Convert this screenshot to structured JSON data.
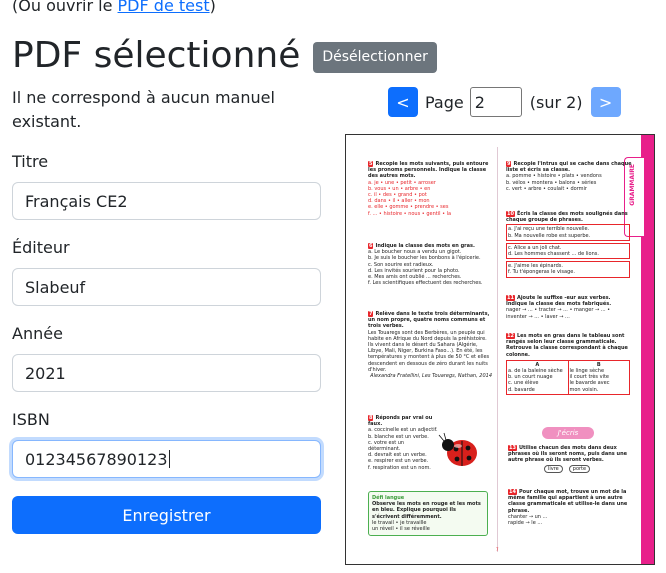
{
  "header": {
    "open_prefix": "(Ou ouvrir le ",
    "open_link": "PDF de test",
    "open_suffix": ")",
    "title": "PDF sélectionné",
    "deselect_label": "Désélectionner"
  },
  "form": {
    "note": "Il ne correspond à aucun manuel existant.",
    "title_label": "Titre",
    "title_value": "Français CE2",
    "publisher_label": "Éditeur",
    "publisher_value": "Slabeuf",
    "year_label": "Année",
    "year_value": "2021",
    "isbn_label": "ISBN",
    "isbn_value": "01234567890123",
    "save_label": "Enregistrer"
  },
  "pager": {
    "prev_label": "<",
    "page_word": "Page",
    "page_value": "2",
    "total_text": "(sur 2)",
    "next_label": ">"
  },
  "pdf": {
    "side_tab": "GRAMMAIRE",
    "page_number": "7",
    "write_banner": "J'écris",
    "ex5": {
      "num": "5",
      "title": "Recopie les mots suivants, puis entoure les pronoms personnels. Indique la classe des autres mots.",
      "lines": [
        "a. je • une • petit • arroser",
        "b. vous • un • arbre • en",
        "c. il • des • grand • pot",
        "d. dans • il • aller • mon",
        "e. elle • gomme • prendre • ses",
        "f. ... • histoire • nous • gentil • la"
      ]
    },
    "ex6": {
      "num": "6",
      "title": "Indique la classe des mots en gras.",
      "lines": [
        "a. Le boucher nous a vendu un gigot.",
        "b. Je suis le boucher les bonbons à l'épicerie.",
        "c. Son sourire est radieux.",
        "d. Les invités sourient pour la photo.",
        "e. Mes amis ont oublié ... recherches.",
        "f. Les scientifiques effectuent des recherches."
      ]
    },
    "ex7": {
      "num": "7",
      "title": "Relève dans le texte trois déterminants, un nom propre, quatre noms communs et trois verbes.",
      "text": "Les Touaregs sont des Berbères, un peuple qui habite en Afrique du Nord depuis la préhistoire. Ils vivent dans le désert du Sahara (Algérie, Libye, Mali, Niger, Burkina Faso...). En été, les températures y montent à plus de 50 °C et elles descendent en dessous de zéro durant les nuits d'hiver.",
      "source": "Alexandra Fratellini, Les Touaregs, Nathan, 2014"
    },
    "ex8": {
      "num": "8",
      "title": "Réponds par vrai ou faux.",
      "lines": [
        "a. coccinelle est un adjectif.",
        "b. blanche est un verbe.",
        "c. votre est un déterminant.",
        "d. devrait est un verbe.",
        "e. respirer est un verbe.",
        "f. respiration est un nom."
      ]
    },
    "defi": {
      "label": "Défi langue",
      "text": "Observe les mots en rouge et les mots en bleu. Explique pourquoi ils s'écrivent différemment.",
      "lines": [
        "le travail • je travaille",
        "un réveil • il se réveille"
      ]
    },
    "ex9": {
      "num": "9",
      "title": "Recopie l'intrus qui se cache dans chaque liste et écris sa classe.",
      "lines": [
        "a. pomme • histoire • plats • vendons",
        "b. vélos • montera • balons • séries",
        "c. vert • arbre • coulait • dormir"
      ]
    },
    "ex10": {
      "num": "10",
      "title": "Écris la classe des mots soulignés dans chaque groupe de phrases.",
      "lines": [
        "a. J'ai reçu une terrible nouvelle.",
        "b. Ma nouvelle robe est superbe.",
        "c. Alice a un joli chat.",
        "d. Les hommes chassent ... de lions.",
        "e. J'aime les épinards.",
        "f. Tu t'épongeras le visage."
      ]
    },
    "ex11": {
      "num": "11",
      "title": "Ajoute le suffixe -eur aux verbes. Indique la classe des mots fabriqués.",
      "text": "nager → ... • tracter → ... • manger → ... • inventer → ... • laver → ..."
    },
    "ex12": {
      "num": "12",
      "title": "Les mots en gras dans le tableau sont rangés selon leur classe grammaticale. Retrouve la classe correspondant à chaque colonne.",
      "col_a": "A",
      "col_b": "B",
      "rows_a": [
        "a. de la baleine sèche",
        "b. un court nuage",
        "c. une élève",
        "d. bavarde"
      ],
      "rows_b": [
        "le linge sèche",
        "il court très vite",
        "le bavarde avec",
        "mon voisin."
      ]
    },
    "ex13": {
      "num": "13",
      "title": "Utilise chacun des mots dans deux phrases où ils seront noms, puis dans une autre phrase où ils seront verbes.",
      "words": [
        "livre",
        "porte"
      ]
    },
    "ex14": {
      "num": "14",
      "title": "Pour chaque mot, trouve un mot de la même famille qui appartient à une autre classe grammaticale et utilise-le dans une phrase.",
      "lines": [
        "chanter → un ...",
        "rapide → le ..."
      ]
    }
  }
}
